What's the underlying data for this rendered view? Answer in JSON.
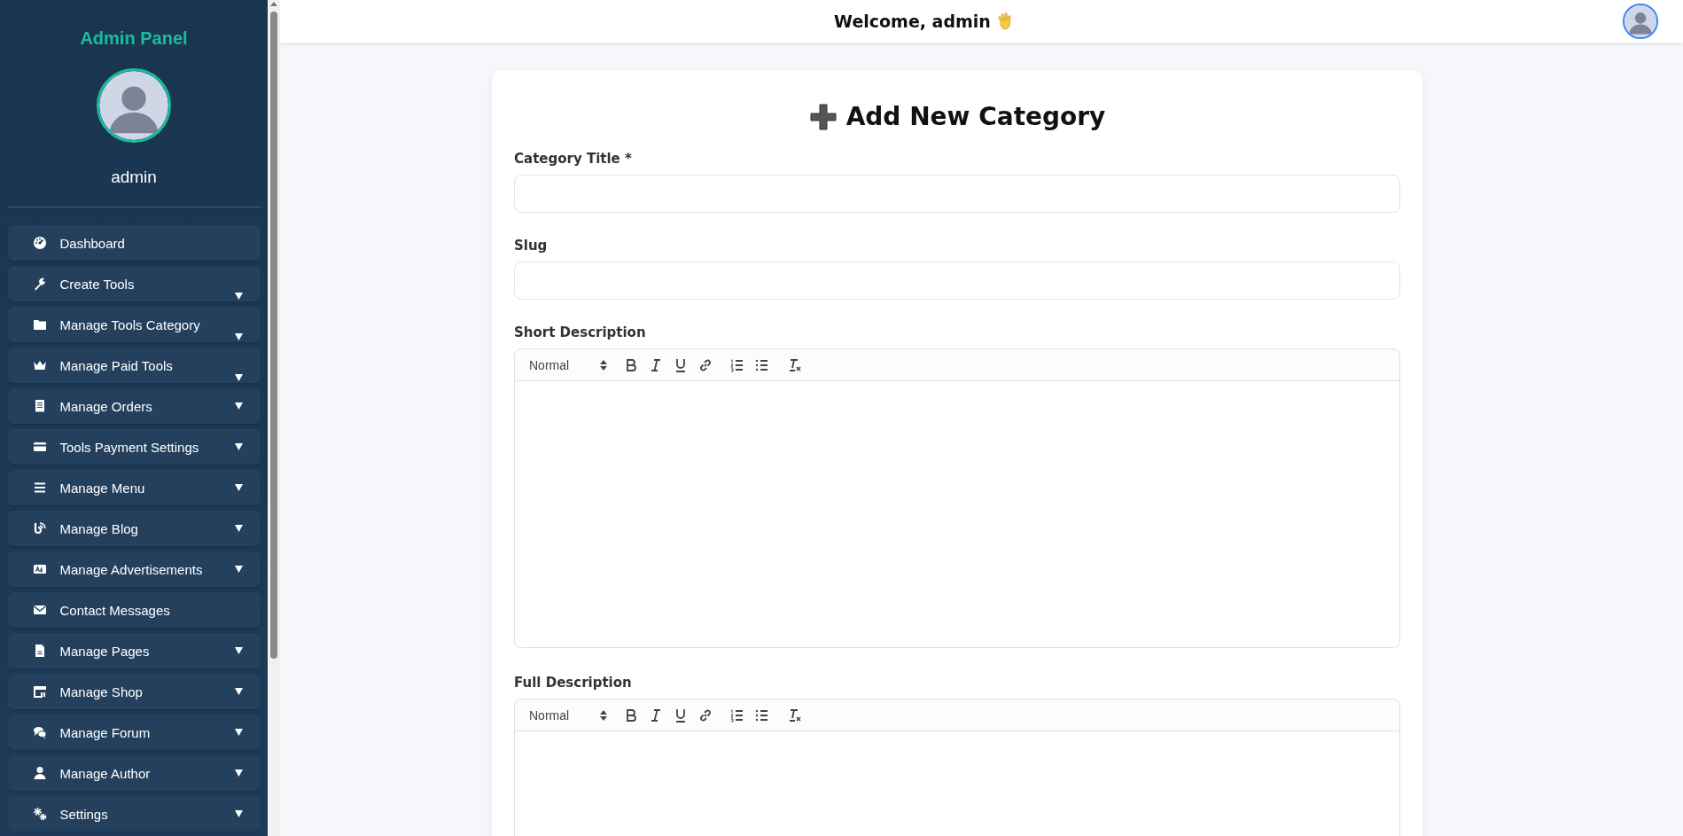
{
  "sidebar": {
    "title": "Admin Panel",
    "username": "admin",
    "items": [
      {
        "label": "Dashboard",
        "kind": "link"
      },
      {
        "label": "Create Tools",
        "kind": "dropdown-low"
      },
      {
        "label": "Manage Tools Category",
        "kind": "dropdown-low"
      },
      {
        "label": "Manage Paid Tools",
        "kind": "dropdown-low"
      },
      {
        "label": "Manage Orders",
        "kind": "dropdown"
      },
      {
        "label": "Tools Payment Settings",
        "kind": "dropdown"
      },
      {
        "label": "Manage Menu",
        "kind": "dropdown"
      },
      {
        "label": "Manage Blog",
        "kind": "dropdown"
      },
      {
        "label": "Manage Advertisements",
        "kind": "dropdown"
      },
      {
        "label": "Contact Messages",
        "kind": "link"
      },
      {
        "label": "Manage Pages",
        "kind": "dropdown"
      },
      {
        "label": "Manage Shop",
        "kind": "dropdown"
      },
      {
        "label": "Manage Forum",
        "kind": "dropdown"
      },
      {
        "label": "Manage Author",
        "kind": "dropdown"
      },
      {
        "label": "Settings",
        "kind": "dropdown"
      }
    ]
  },
  "header": {
    "greeting": "Welcome, admin"
  },
  "form": {
    "title": "Add New Category",
    "fields": [
      {
        "kind": "text",
        "label": "Category Title *"
      },
      {
        "kind": "text",
        "label": "Slug"
      },
      {
        "kind": "editor",
        "label": "Short Description",
        "format": "Normal"
      },
      {
        "kind": "editor",
        "label": "Full Description",
        "format": "Normal"
      }
    ]
  }
}
